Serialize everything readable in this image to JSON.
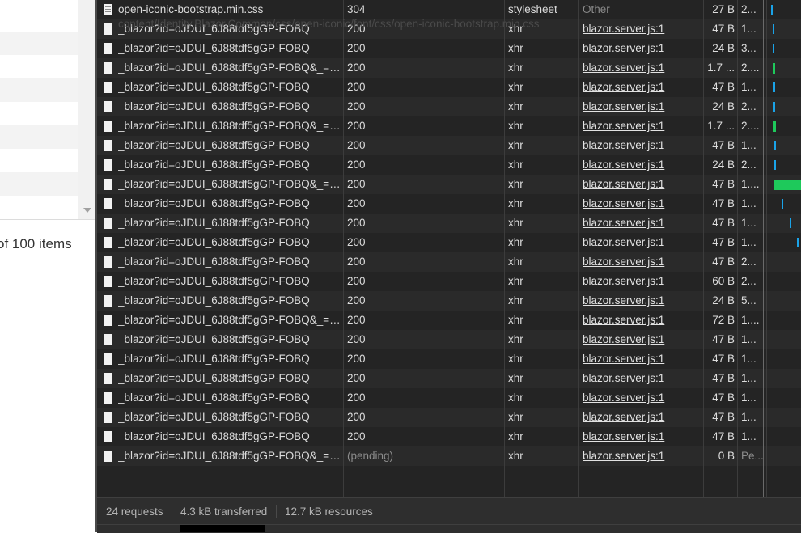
{
  "left_pane": {
    "pager_text": "of 100 items"
  },
  "network": {
    "ghost_tooltip": "content/Identity.Blazor.Common/css/open-iconic/font/css/open-iconic-bootstrap.min.css",
    "rows": [
      {
        "name": "open-iconic-bootstrap.min.css",
        "status": "304",
        "type": "stylesheet",
        "initiator": "Other",
        "size": "27 B",
        "time": "2...",
        "icon": "document-icon",
        "initiator_link": false
      },
      {
        "name": "_blazor?id=oJDUI_6J88tdf5gGP-FOBQ",
        "status": "200",
        "type": "xhr",
        "initiator": "blazor.server.js:1",
        "size": "47 B",
        "time": "1...",
        "icon": "blank-file-icon",
        "initiator_link": true
      },
      {
        "name": "_blazor?id=oJDUI_6J88tdf5gGP-FOBQ",
        "status": "200",
        "type": "xhr",
        "initiator": "blazor.server.js:1",
        "size": "24 B",
        "time": "3...",
        "icon": "blank-file-icon",
        "initiator_link": true
      },
      {
        "name": "_blazor?id=oJDUI_6J88tdf5gGP-FOBQ&_=1...",
        "status": "200",
        "type": "xhr",
        "initiator": "blazor.server.js:1",
        "size": "1.7 ...",
        "time": "2....",
        "icon": "blank-file-icon",
        "initiator_link": true
      },
      {
        "name": "_blazor?id=oJDUI_6J88tdf5gGP-FOBQ",
        "status": "200",
        "type": "xhr",
        "initiator": "blazor.server.js:1",
        "size": "47 B",
        "time": "1...",
        "icon": "blank-file-icon",
        "initiator_link": true
      },
      {
        "name": "_blazor?id=oJDUI_6J88tdf5gGP-FOBQ",
        "status": "200",
        "type": "xhr",
        "initiator": "blazor.server.js:1",
        "size": "24 B",
        "time": "2...",
        "icon": "blank-file-icon",
        "initiator_link": true
      },
      {
        "name": "_blazor?id=oJDUI_6J88tdf5gGP-FOBQ&_=1...",
        "status": "200",
        "type": "xhr",
        "initiator": "blazor.server.js:1",
        "size": "1.7 ...",
        "time": "2....",
        "icon": "blank-file-icon",
        "initiator_link": true
      },
      {
        "name": "_blazor?id=oJDUI_6J88tdf5gGP-FOBQ",
        "status": "200",
        "type": "xhr",
        "initiator": "blazor.server.js:1",
        "size": "47 B",
        "time": "1...",
        "icon": "blank-file-icon",
        "initiator_link": true
      },
      {
        "name": "_blazor?id=oJDUI_6J88tdf5gGP-FOBQ",
        "status": "200",
        "type": "xhr",
        "initiator": "blazor.server.js:1",
        "size": "24 B",
        "time": "2...",
        "icon": "blank-file-icon",
        "initiator_link": true
      },
      {
        "name": "_blazor?id=oJDUI_6J88tdf5gGP-FOBQ&_=1...",
        "status": "200",
        "type": "xhr",
        "initiator": "blazor.server.js:1",
        "size": "47 B",
        "time": "1....",
        "icon": "blank-file-icon",
        "initiator_link": true
      },
      {
        "name": "_blazor?id=oJDUI_6J88tdf5gGP-FOBQ",
        "status": "200",
        "type": "xhr",
        "initiator": "blazor.server.js:1",
        "size": "47 B",
        "time": "1...",
        "icon": "blank-file-icon",
        "initiator_link": true
      },
      {
        "name": "_blazor?id=oJDUI_6J88tdf5gGP-FOBQ",
        "status": "200",
        "type": "xhr",
        "initiator": "blazor.server.js:1",
        "size": "47 B",
        "time": "1...",
        "icon": "blank-file-icon",
        "initiator_link": true
      },
      {
        "name": "_blazor?id=oJDUI_6J88tdf5gGP-FOBQ",
        "status": "200",
        "type": "xhr",
        "initiator": "blazor.server.js:1",
        "size": "47 B",
        "time": "1...",
        "icon": "blank-file-icon",
        "initiator_link": true
      },
      {
        "name": "_blazor?id=oJDUI_6J88tdf5gGP-FOBQ",
        "status": "200",
        "type": "xhr",
        "initiator": "blazor.server.js:1",
        "size": "47 B",
        "time": "2...",
        "icon": "blank-file-icon",
        "initiator_link": true
      },
      {
        "name": "_blazor?id=oJDUI_6J88tdf5gGP-FOBQ",
        "status": "200",
        "type": "xhr",
        "initiator": "blazor.server.js:1",
        "size": "60 B",
        "time": "2...",
        "icon": "blank-file-icon",
        "initiator_link": true
      },
      {
        "name": "_blazor?id=oJDUI_6J88tdf5gGP-FOBQ",
        "status": "200",
        "type": "xhr",
        "initiator": "blazor.server.js:1",
        "size": "24 B",
        "time": "5...",
        "icon": "blank-file-icon",
        "initiator_link": true
      },
      {
        "name": "_blazor?id=oJDUI_6J88tdf5gGP-FOBQ&_=1...",
        "status": "200",
        "type": "xhr",
        "initiator": "blazor.server.js:1",
        "size": "72 B",
        "time": "1....",
        "icon": "blank-file-icon",
        "initiator_link": true
      },
      {
        "name": "_blazor?id=oJDUI_6J88tdf5gGP-FOBQ",
        "status": "200",
        "type": "xhr",
        "initiator": "blazor.server.js:1",
        "size": "47 B",
        "time": "1...",
        "icon": "blank-file-icon",
        "initiator_link": true
      },
      {
        "name": "_blazor?id=oJDUI_6J88tdf5gGP-FOBQ",
        "status": "200",
        "type": "xhr",
        "initiator": "blazor.server.js:1",
        "size": "47 B",
        "time": "1...",
        "icon": "blank-file-icon",
        "initiator_link": true
      },
      {
        "name": "_blazor?id=oJDUI_6J88tdf5gGP-FOBQ",
        "status": "200",
        "type": "xhr",
        "initiator": "blazor.server.js:1",
        "size": "47 B",
        "time": "1...",
        "icon": "blank-file-icon",
        "initiator_link": true
      },
      {
        "name": "_blazor?id=oJDUI_6J88tdf5gGP-FOBQ",
        "status": "200",
        "type": "xhr",
        "initiator": "blazor.server.js:1",
        "size": "47 B",
        "time": "1...",
        "icon": "blank-file-icon",
        "initiator_link": true
      },
      {
        "name": "_blazor?id=oJDUI_6J88tdf5gGP-FOBQ",
        "status": "200",
        "type": "xhr",
        "initiator": "blazor.server.js:1",
        "size": "47 B",
        "time": "1...",
        "icon": "blank-file-icon",
        "initiator_link": true
      },
      {
        "name": "_blazor?id=oJDUI_6J88tdf5gGP-FOBQ",
        "status": "200",
        "type": "xhr",
        "initiator": "blazor.server.js:1",
        "size": "47 B",
        "time": "1...",
        "icon": "blank-file-icon",
        "initiator_link": true
      },
      {
        "name": "_blazor?id=oJDUI_6J88tdf5gGP-FOBQ&_=1...",
        "status": "(pending)",
        "type": "xhr",
        "initiator": "blazor.server.js:1",
        "size": "0 B",
        "time": "Pe...",
        "icon": "blank-file-icon",
        "initiator_link": true,
        "pending": true
      }
    ]
  },
  "status_bar": {
    "requests": "24 requests",
    "transferred": "4.3 kB transferred",
    "resources": "12.7 kB resources"
  },
  "colors": {
    "waterfall_waiting": "#1aa3e8",
    "waterfall_download": "#1ec95b",
    "panel_background": "#242424"
  }
}
